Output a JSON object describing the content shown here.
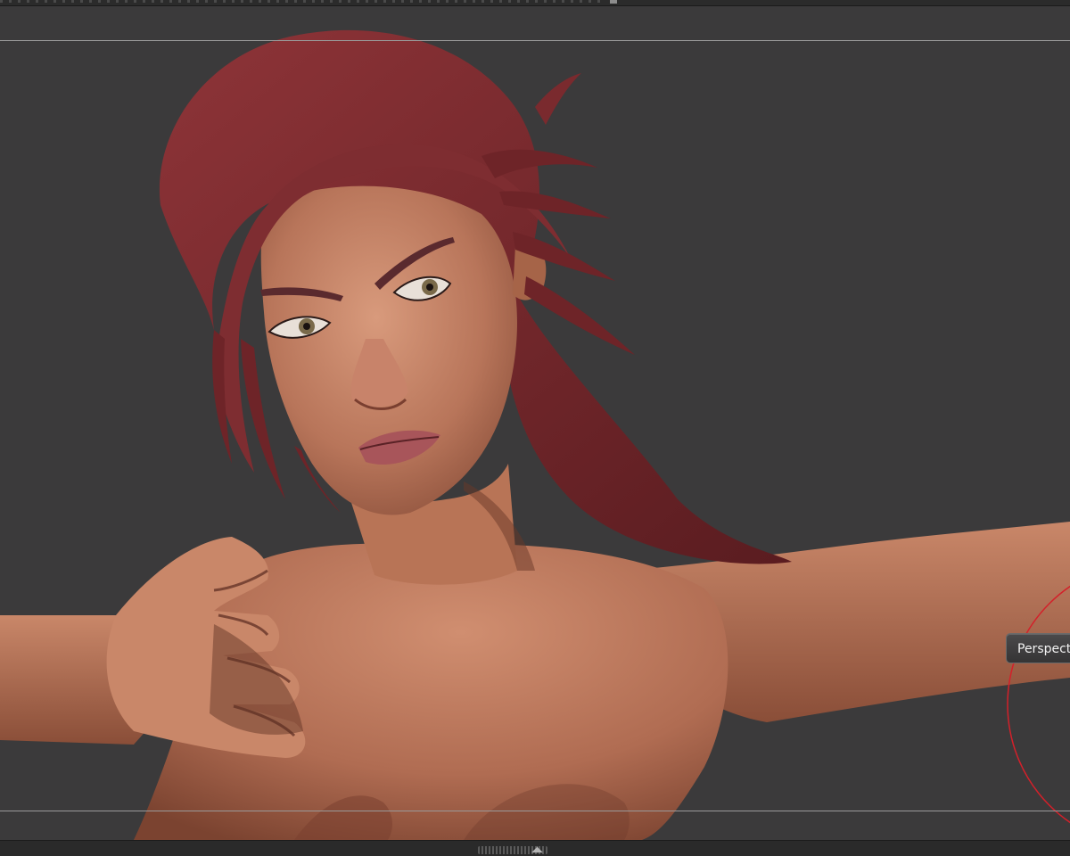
{
  "canvas": {
    "background_color": "#3b3a3b",
    "frame_line_color": "#9a9a9a",
    "brush_cursor_color": "#d4202a",
    "skin_color": "#c07a5e",
    "hair_color": "#7a2a2e"
  },
  "viewport": {
    "perspective_button_label": "Perspect"
  },
  "icons": {
    "collapse_arrows": "◢◣",
    "collapse_arrows_name": "expand-collapse-arrows-icon"
  }
}
